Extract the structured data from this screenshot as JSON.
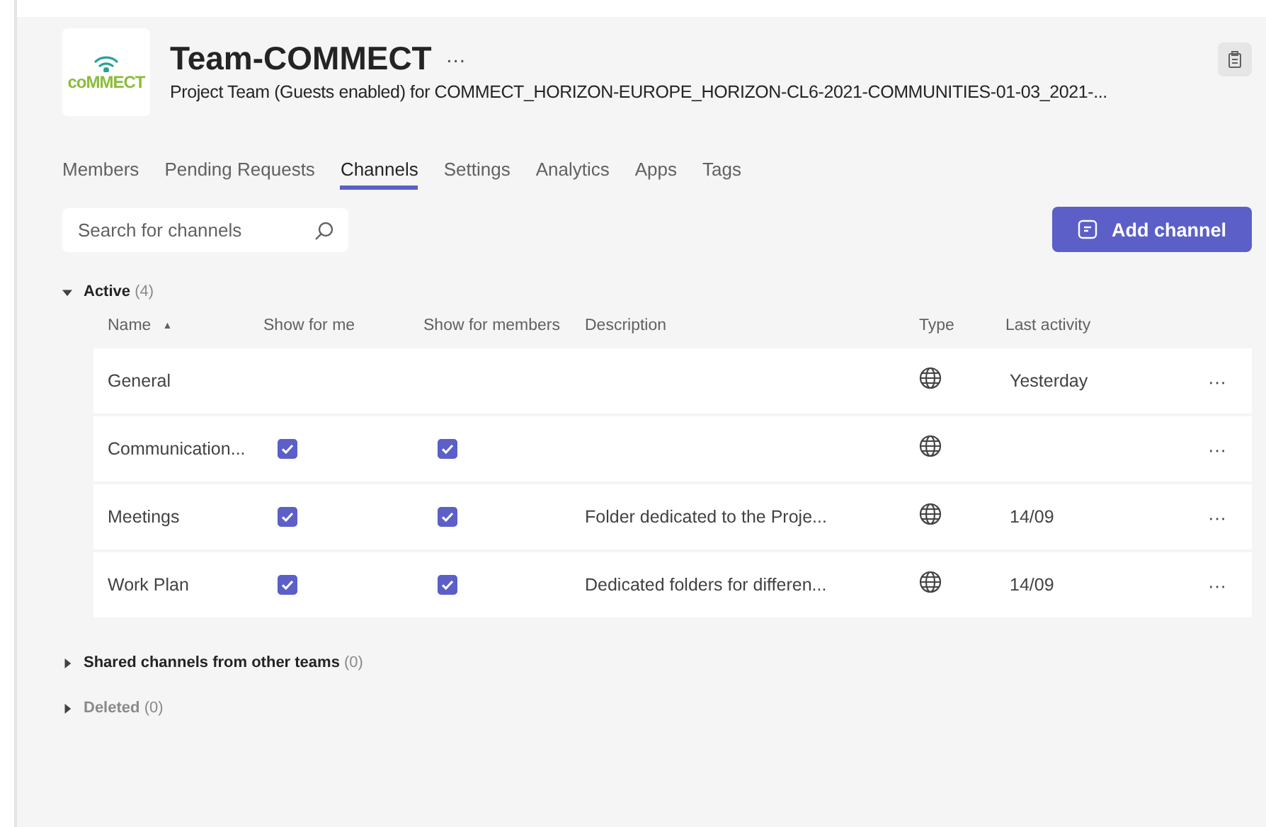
{
  "team": {
    "logo_text": "coMMECT",
    "name": "Team-COMMECT",
    "more": "···",
    "description": "Project Team (Guests enabled) for COMMECT_HORIZON-EUROPE_HORIZON-CL6-2021-COMMUNITIES-01-03_2021-..."
  },
  "tabs": [
    {
      "label": "Members",
      "selected": false
    },
    {
      "label": "Pending Requests",
      "selected": false
    },
    {
      "label": "Channels",
      "selected": true
    },
    {
      "label": "Settings",
      "selected": false
    },
    {
      "label": "Analytics",
      "selected": false
    },
    {
      "label": "Apps",
      "selected": false
    },
    {
      "label": "Tags",
      "selected": false
    }
  ],
  "search": {
    "placeholder": "Search for channels"
  },
  "add_button": {
    "label": "Add channel"
  },
  "sections": [
    {
      "title": "Active",
      "count": "(4)",
      "expanded": true,
      "disabled": false
    },
    {
      "title": "Shared channels from other teams",
      "count": "(0)",
      "expanded": false,
      "disabled": false
    },
    {
      "title": "Deleted",
      "count": "(0)",
      "expanded": false,
      "disabled": true
    }
  ],
  "table": {
    "columns": [
      "Name",
      "Show for me",
      "Show for members",
      "Description",
      "Type",
      "Last activity"
    ],
    "sort_mark": "▲",
    "rows": [
      {
        "name": "General",
        "last_activity": "Yesterday",
        "more": "···"
      },
      {
        "name": "Communication...",
        "show_for_me": true,
        "show_for_members": true,
        "more": "···"
      },
      {
        "name": "Meetings",
        "show_for_me": true,
        "show_for_members": true,
        "description": "Folder dedicated to the Proje...",
        "last_activity": "14/09",
        "more": "···"
      },
      {
        "name": "Work Plan",
        "show_for_me": true,
        "show_for_members": true,
        "description": "Dedicated folders for differen...",
        "last_activity": "14/09",
        "more": "···"
      }
    ]
  }
}
